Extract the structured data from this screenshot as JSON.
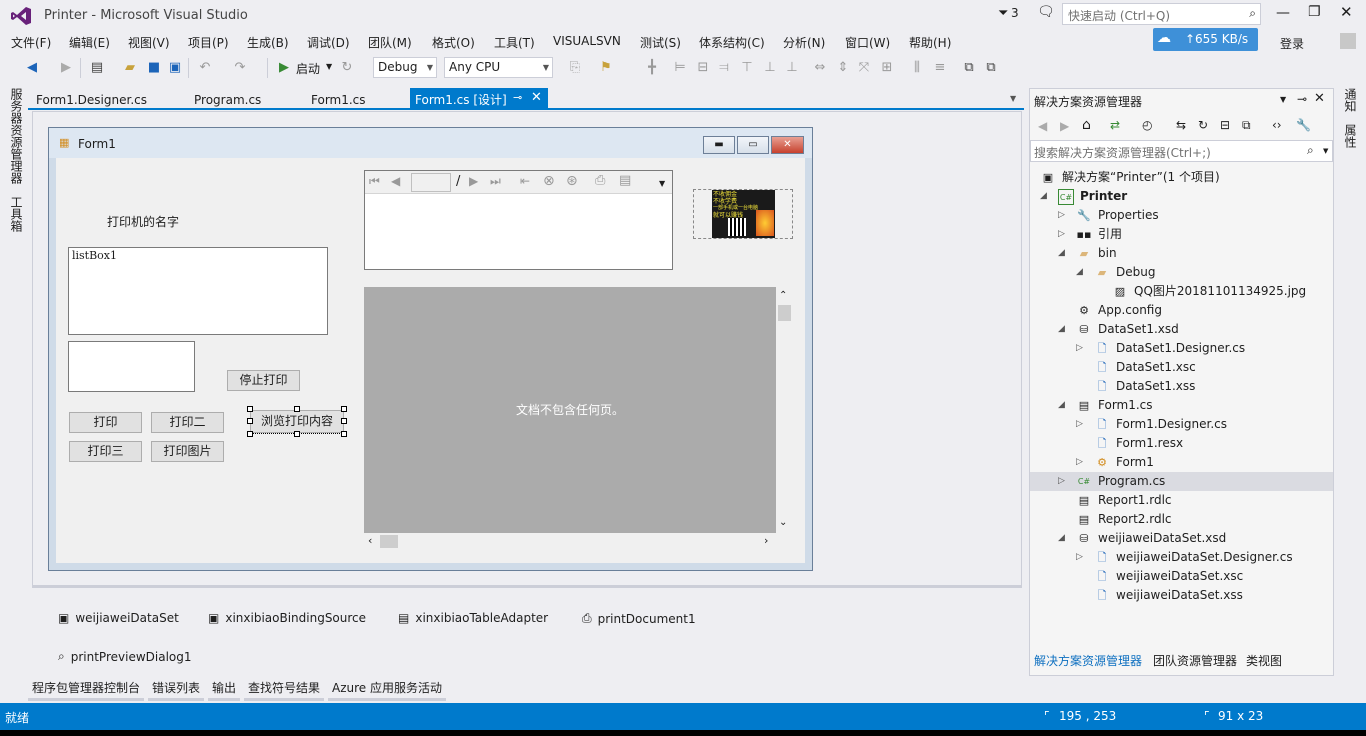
{
  "window": {
    "title": "Printer - Microsoft Visual Studio",
    "notification_count": "3",
    "quick_launch_placeholder": "快速启动 (Ctrl+Q)",
    "speed": "655 KB/s",
    "login": "登录"
  },
  "menu": [
    "文件(F)",
    "编辑(E)",
    "视图(V)",
    "项目(P)",
    "生成(B)",
    "调试(D)",
    "团队(M)",
    "格式(O)",
    "工具(T)",
    "VISUALSVN",
    "测试(S)",
    "体系结构(C)",
    "分析(N)",
    "窗口(W)",
    "帮助(H)"
  ],
  "toolbar": {
    "start_label": "启动",
    "config": "Debug",
    "platform": "Any CPU"
  },
  "left_tabs": [
    "服务器资源管理器",
    "工具箱"
  ],
  "doc_tabs": [
    "Form1.Designer.cs",
    "Program.cs",
    "Form1.cs",
    "Form1.cs [设计]"
  ],
  "form": {
    "title": "Form1",
    "printer_label": "打印机的名字",
    "listbox": "listBox1",
    "stop_button": "停止打印",
    "print_button": "打印",
    "print2_button": "打印二",
    "print3_button": "打印三",
    "print_image_button": "打印图片",
    "preview_button": "浏览打印内容",
    "page_separator": "/",
    "preview_empty": "文档不包含任何页。",
    "qr_text": [
      "不收佣金",
      "不收学费",
      "一部手机或一台电脑",
      "就可以赚钱"
    ]
  },
  "tray": [
    "weijiaweiDataSet",
    "xinxibiaoBindingSource",
    "xinxibiaoTableAdapter",
    "printDocument1",
    "printPreviewDialog1"
  ],
  "bottom_tabs": [
    "程序包管理器控制台",
    "错误列表",
    "输出",
    "查找符号结果",
    "Azure 应用服务活动"
  ],
  "status": {
    "left": "就绪",
    "position": "195 , 253",
    "size": "91 x 23"
  },
  "solution": {
    "header": "解决方案资源管理器",
    "search_placeholder": "搜索解决方案资源管理器(Ctrl+;)",
    "root": "解决方案“Printer”(1 个项目)",
    "items": [
      {
        "label": "Printer",
        "bold": true
      },
      {
        "label": "Properties"
      },
      {
        "label": "引用"
      },
      {
        "label": "bin"
      },
      {
        "label": "Debug"
      },
      {
        "label": "QQ图片20181101134925.jpg"
      },
      {
        "label": "App.config"
      },
      {
        "label": "DataSet1.xsd"
      },
      {
        "label": "DataSet1.Designer.cs"
      },
      {
        "label": "DataSet1.xsc"
      },
      {
        "label": "DataSet1.xss"
      },
      {
        "label": "Form1.cs"
      },
      {
        "label": "Form1.Designer.cs"
      },
      {
        "label": "Form1.resx"
      },
      {
        "label": "Form1"
      },
      {
        "label": "Program.cs"
      },
      {
        "label": "Report1.rdlc"
      },
      {
        "label": "Report2.rdlc"
      },
      {
        "label": "weijiaweiDataSet.xsd"
      },
      {
        "label": "weijiaweiDataSet.Designer.cs"
      },
      {
        "label": "weijiaweiDataSet.xsc"
      },
      {
        "label": "weijiaweiDataSet.xss"
      }
    ],
    "bottom_tabs": [
      "解决方案资源管理器",
      "团队资源管理器",
      "类视图"
    ]
  },
  "right_tabs": [
    "通知",
    "属性"
  ],
  "colors": {
    "accent": "#007acc",
    "selected_row": "#dadbe1",
    "vs_purple": "#68217a"
  }
}
